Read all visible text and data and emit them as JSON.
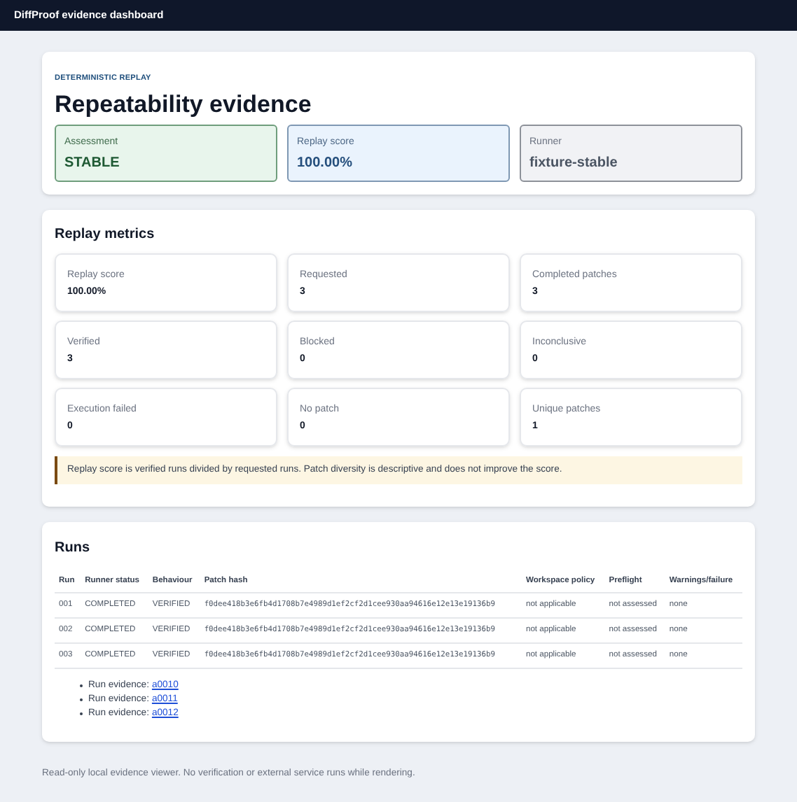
{
  "header": {
    "title": "DiffProof evidence dashboard"
  },
  "summary": {
    "eyebrow": "DETERMINISTIC REPLAY",
    "title": "Repeatability evidence",
    "cards": [
      {
        "label": "Assessment",
        "value": "STABLE",
        "kind": "success"
      },
      {
        "label": "Replay score",
        "value": "100.00%",
        "kind": "info"
      },
      {
        "label": "Runner",
        "value": "fixture-stable",
        "kind": "neutral"
      }
    ]
  },
  "metrics": {
    "title": "Replay metrics",
    "items": [
      {
        "label": "Replay score",
        "value": "100.00%"
      },
      {
        "label": "Requested",
        "value": "3"
      },
      {
        "label": "Completed patches",
        "value": "3"
      },
      {
        "label": "Verified",
        "value": "3"
      },
      {
        "label": "Blocked",
        "value": "0"
      },
      {
        "label": "Inconclusive",
        "value": "0"
      },
      {
        "label": "Execution failed",
        "value": "0"
      },
      {
        "label": "No patch",
        "value": "0"
      },
      {
        "label": "Unique patches",
        "value": "1"
      }
    ],
    "note": "Replay score is verified runs divided by requested runs. Patch diversity is descriptive and does not improve the score."
  },
  "runs": {
    "title": "Runs",
    "columns": [
      "Run",
      "Runner status",
      "Behaviour",
      "Patch hash",
      "Workspace policy",
      "Preflight",
      "Warnings/failure"
    ],
    "rows": [
      [
        "001",
        "COMPLETED",
        "VERIFIED",
        "f0dee418b3e6fb4d1708b7e4989d1ef2cf2d1cee930aa94616e12e13e19136b9",
        "not applicable",
        "not assessed",
        "none"
      ],
      [
        "002",
        "COMPLETED",
        "VERIFIED",
        "f0dee418b3e6fb4d1708b7e4989d1ef2cf2d1cee930aa94616e12e13e19136b9",
        "not applicable",
        "not assessed",
        "none"
      ],
      [
        "003",
        "COMPLETED",
        "VERIFIED",
        "f0dee418b3e6fb4d1708b7e4989d1ef2cf2d1cee930aa94616e12e13e19136b9",
        "not applicable",
        "not assessed",
        "none"
      ]
    ],
    "evidence": [
      {
        "label": "Run evidence:",
        "link": "a0010"
      },
      {
        "label": "Run evidence:",
        "link": "a0011"
      },
      {
        "label": "Run evidence:",
        "link": "a0012"
      }
    ]
  },
  "footer": "Read-only local evidence viewer. No verification or external service runs while rendering."
}
